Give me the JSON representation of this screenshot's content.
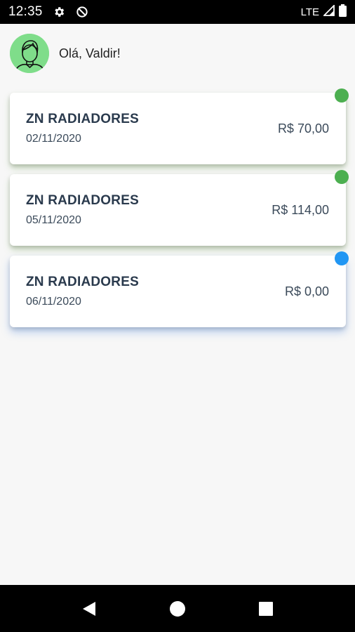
{
  "status_bar": {
    "time": "12:35",
    "network": "LTE",
    "icons": [
      "settings-icon",
      "sync-off-icon",
      "signal-icon",
      "battery-icon"
    ]
  },
  "header": {
    "greeting": "Olá, Valdir!",
    "avatar_icon": "user-avatar-icon"
  },
  "cards": [
    {
      "title": "ZN RADIADORES",
      "date": "02/11/2020",
      "amount": "R$ 70,00",
      "status_color": "#4caf50"
    },
    {
      "title": "ZN RADIADORES",
      "date": "05/11/2020",
      "amount": "R$ 114,00",
      "status_color": "#4caf50"
    },
    {
      "title": "ZN RADIADORES",
      "date": "06/11/2020",
      "amount": "R$ 0,00",
      "status_color": "#2196f3"
    }
  ],
  "nav_bar": {
    "buttons": [
      "back-icon",
      "home-icon",
      "recents-icon"
    ]
  }
}
